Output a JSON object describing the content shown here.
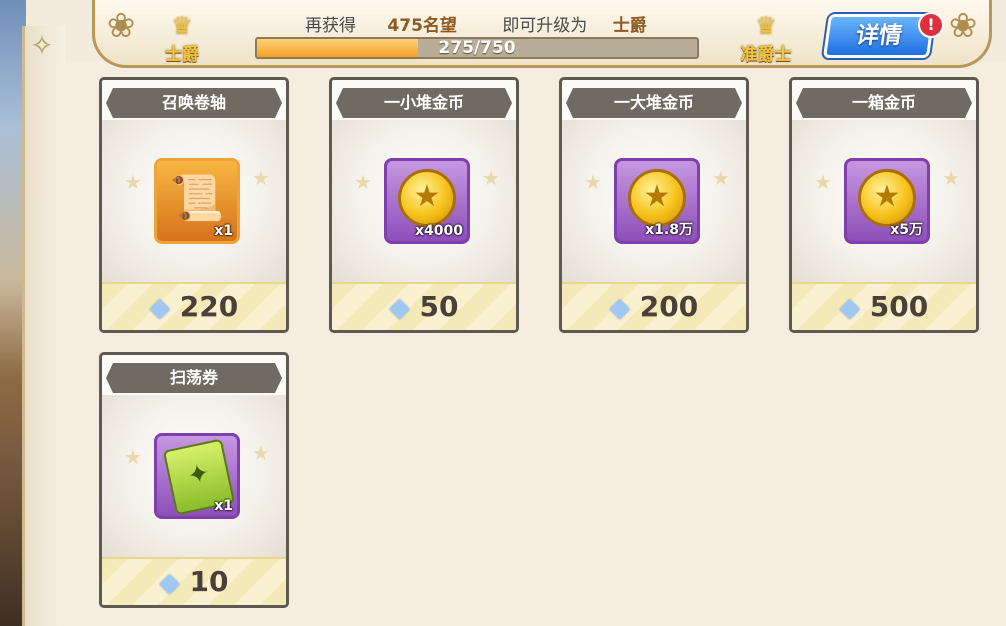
{
  "header": {
    "current_rank": "士爵",
    "next_rank": "准爵士",
    "prompt_prefix": "再获得",
    "prestige_needed": "475名望",
    "prompt_middle": "即可升级为",
    "target_rank": "士爵",
    "progress_text": "275/750",
    "progress_fraction": 0.3667,
    "details_label": "详情",
    "alert_mark": "!"
  },
  "shop": {
    "items": [
      {
        "title": "召唤卷轴",
        "qty": "x1",
        "price": "220",
        "frame": "orange",
        "icon": "summon-scroll-icon"
      },
      {
        "title": "一小堆金币",
        "qty": "x4000",
        "price": "50",
        "frame": "purple",
        "icon": "gold-coin-icon"
      },
      {
        "title": "一大堆金币",
        "qty": "x1.8万",
        "price": "200",
        "frame": "purple",
        "icon": "gold-coin-icon"
      },
      {
        "title": "一箱金币",
        "qty": "x5万",
        "price": "500",
        "frame": "purple",
        "icon": "gold-coin-icon"
      },
      {
        "title": "扫荡券",
        "qty": "x1",
        "price": "10",
        "frame": "purple",
        "icon": "sweep-ticket-icon"
      }
    ]
  },
  "colors": {
    "accent_blue": "#1f6fe0",
    "progress_orange": "#f3a128",
    "rank_gold": "#f4c542"
  }
}
